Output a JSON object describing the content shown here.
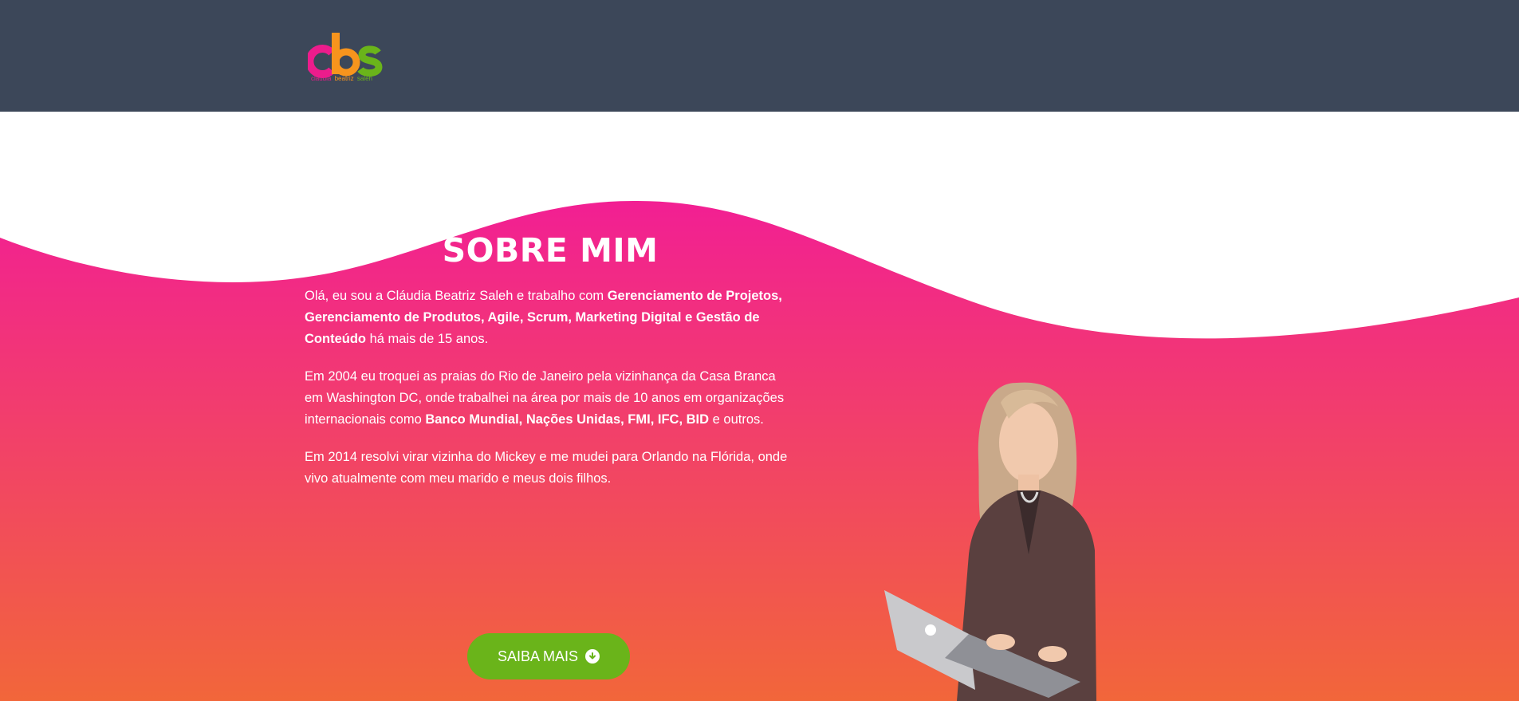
{
  "header": {
    "logo": {
      "letters": "cbs",
      "tagline_parts": [
        "cláudia",
        "beatriz",
        "saleh"
      ]
    }
  },
  "about": {
    "title": "SOBRE MIM",
    "p1": {
      "t1": "Olá, eu sou a Cláudia Beatriz Saleh e trabalho com ",
      "b1": "Gerenciamento de Projetos, Gerenciamento de Produtos, Agile, Scrum, Marketing Digital e Gestão de Conteúdo",
      "t2": " há mais de 15 anos."
    },
    "p2": {
      "t1": "Em 2004 eu troquei as praias do Rio de Janeiro pela vizinhança da Casa Branca em Washington DC, onde trabalhei na área por mais de 10 anos em organizações internacionais como ",
      "b1": "Banco Mundial, Nações Unidas, FMI, IFC, BID",
      "t2": " e outros."
    },
    "p3": {
      "t1": "Em 2014 resolvi virar vizinha do Mickey e me mudei para Orlando na Flórida, onde vivo atualmente com meu marido e meus dois filhos."
    },
    "cta_label": "SAIBA MAIS",
    "cta_icon": "arrow-down-circle-icon"
  },
  "colors": {
    "header_bg": "#3c4759",
    "gradient_top": "#f21f93",
    "gradient_bottom": "#f2663a",
    "cta_bg": "#6ab41a",
    "logo_pink": "#ec1c8c",
    "logo_orange": "#f7941d",
    "logo_green": "#6ab41a"
  }
}
